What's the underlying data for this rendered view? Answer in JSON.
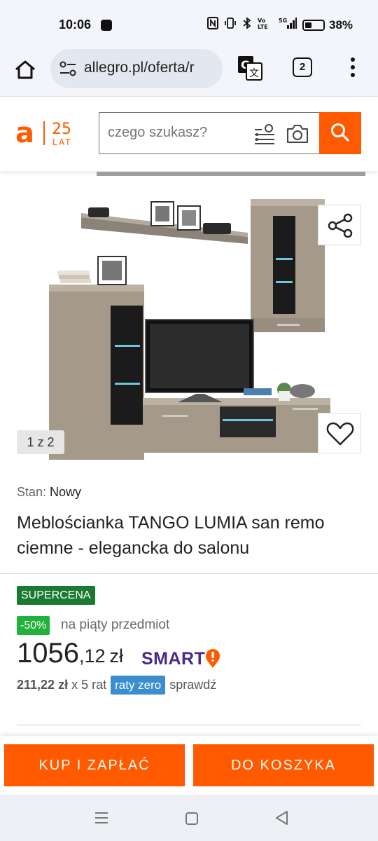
{
  "status_bar": {
    "time": "10:06",
    "battery_percent": "38%",
    "battery_level": 0.38,
    "icons": [
      "nfc-icon",
      "vibrate-icon",
      "bluetooth-icon",
      "volte-icon",
      "signal-5g-icon",
      "battery-icon"
    ]
  },
  "browser": {
    "url": "allegro.pl/oferta/r",
    "tab_count": "2"
  },
  "header": {
    "logo_letter": "a",
    "logo_years": "25",
    "logo_lat": "LAT",
    "search_placeholder": "czego szukasz?"
  },
  "gallery": {
    "counter": "1 z 2"
  },
  "product": {
    "condition_label": "Stan:",
    "condition_value": "Nowy",
    "title": "Meblościanka TANGO LUMIA san remo ciemne - elegancka do salonu",
    "badge": "SUPERCENA",
    "discount": "-50%",
    "discount_text": "na piąty przedmiot",
    "price_int": "1056",
    "price_dec": ",12",
    "currency": "zł",
    "smart_label": "SMART",
    "installment_amount": "211,22 zł",
    "installment_count": "x 5 rat",
    "installment_badge": "raty zero",
    "installment_link": "sprawdź"
  },
  "actions": {
    "buy": "KUP I ZAPŁAĆ",
    "cart": "DO KOSZYKA"
  },
  "colors": {
    "brand_orange": "#ff5a00",
    "supercena_green": "#1a7a31",
    "discount_green": "#22b13a",
    "raty_blue": "#3a8ed0",
    "smart_purple": "#4a2a8a"
  }
}
